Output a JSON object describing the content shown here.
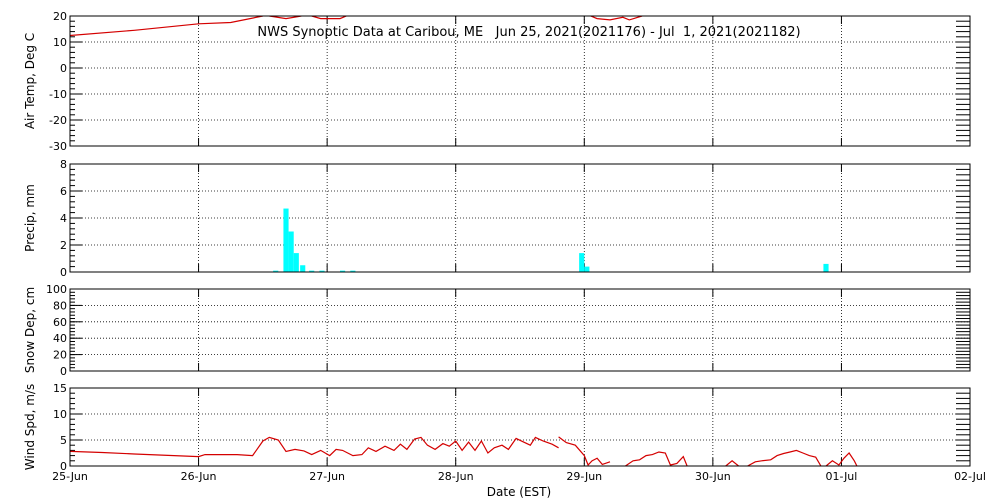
{
  "chart_data": {
    "type": "line",
    "title": "NWS Synoptic Data at Caribou, ME   Jun 25, 2021(2021176) - Jul  1, 2021(2021182)",
    "xlabel": "Date (EST)",
    "x_ticks": [
      "25-Jun",
      "26-Jun",
      "27-Jun",
      "28-Jun",
      "29-Jun",
      "30-Jun",
      "01-Jul",
      "02-Jul"
    ],
    "x_range_days": [
      0,
      7
    ],
    "grid": true,
    "panels": [
      {
        "id": "air-temp",
        "type": "line",
        "ylabel": "Air Temp, Deg C",
        "ylim": [
          -30,
          20
        ],
        "yticks": [
          20,
          10,
          0,
          -10,
          -20,
          -30
        ],
        "color": "#d40000",
        "segments": [
          [
            [
              0.0,
              12.5
            ],
            [
              0.5,
              14.5
            ],
            [
              1.0,
              17.0
            ],
            [
              1.25,
              17.5
            ],
            [
              1.4,
              19.0
            ],
            [
              1.5,
              20.0
            ]
          ],
          [
            [
              1.55,
              20.0
            ],
            [
              1.68,
              19.0
            ],
            [
              1.8,
              20.0
            ]
          ],
          [
            [
              1.88,
              20.0
            ],
            [
              1.95,
              19.0
            ],
            [
              2.1,
              19.0
            ],
            [
              2.15,
              20.0
            ]
          ],
          [
            [
              4.05,
              20.0
            ],
            [
              4.1,
              19.0
            ],
            [
              4.2,
              18.5
            ],
            [
              4.3,
              19.5
            ],
            [
              4.35,
              18.5
            ],
            [
              4.45,
              20.0
            ]
          ]
        ]
      },
      {
        "id": "precip",
        "type": "bar",
        "ylabel": "Precip, mm",
        "ylim": [
          0,
          8
        ],
        "yticks": [
          8,
          6,
          4,
          2,
          0
        ],
        "color": "#00ffff",
        "bar_width_days": 0.04,
        "bars": [
          [
            1.6,
            0.1
          ],
          [
            1.68,
            4.7
          ],
          [
            1.72,
            3.0
          ],
          [
            1.76,
            1.4
          ],
          [
            1.81,
            0.5
          ],
          [
            1.88,
            0.1
          ],
          [
            1.96,
            0.1
          ],
          [
            2.12,
            0.1
          ],
          [
            2.2,
            0.1
          ],
          [
            3.98,
            1.4
          ],
          [
            4.02,
            0.4
          ],
          [
            5.88,
            0.6
          ]
        ]
      },
      {
        "id": "snow-depth",
        "type": "line",
        "ylabel": "Snow Dep, cm",
        "ylim": [
          0,
          100
        ],
        "yticks": [
          100,
          80,
          60,
          40,
          20,
          0
        ],
        "color": "#d40000",
        "segments": []
      },
      {
        "id": "wind-speed",
        "type": "line",
        "ylabel": "Wind Spd, m/s",
        "ylim": [
          0,
          15
        ],
        "yticks": [
          15,
          10,
          5,
          0
        ],
        "color": "#d40000",
        "segments": [
          [
            [
              0.0,
              2.8
            ],
            [
              0.25,
              2.6
            ],
            [
              0.5,
              2.3
            ],
            [
              1.0,
              1.8
            ],
            [
              1.05,
              2.2
            ],
            [
              1.3,
              2.2
            ],
            [
              1.42,
              2.0
            ],
            [
              1.5,
              4.8
            ],
            [
              1.55,
              5.5
            ],
            [
              1.62,
              5.0
            ],
            [
              1.68,
              2.8
            ],
            [
              1.75,
              3.2
            ],
            [
              1.82,
              2.9
            ],
            [
              1.88,
              2.2
            ],
            [
              1.95,
              3.0
            ],
            [
              2.02,
              2.0
            ],
            [
              2.07,
              3.2
            ],
            [
              2.12,
              3.0
            ],
            [
              2.2,
              2.0
            ],
            [
              2.27,
              2.2
            ],
            [
              2.32,
              3.5
            ],
            [
              2.38,
              2.8
            ],
            [
              2.45,
              3.8
            ],
            [
              2.52,
              3.0
            ],
            [
              2.57,
              4.2
            ],
            [
              2.62,
              3.2
            ],
            [
              2.68,
              5.2
            ],
            [
              2.73,
              5.5
            ],
            [
              2.78,
              4.0
            ],
            [
              2.84,
              3.2
            ],
            [
              2.9,
              4.3
            ],
            [
              2.95,
              3.8
            ],
            [
              3.0,
              4.8
            ],
            [
              3.05,
              3.0
            ],
            [
              3.1,
              4.6
            ],
            [
              3.15,
              3.0
            ],
            [
              3.2,
              4.8
            ],
            [
              3.25,
              2.5
            ],
            [
              3.3,
              3.5
            ],
            [
              3.36,
              4.0
            ],
            [
              3.41,
              3.2
            ],
            [
              3.47,
              5.3
            ],
            [
              3.52,
              4.7
            ],
            [
              3.58,
              4.0
            ],
            [
              3.62,
              5.5
            ],
            [
              3.68,
              4.8
            ],
            [
              3.75,
              4.2
            ],
            [
              3.8,
              3.5
            ]
          ],
          [
            [
              3.8,
              5.6
            ],
            [
              3.86,
              4.5
            ],
            [
              3.93,
              4.0
            ],
            [
              4.0,
              2.0
            ],
            [
              4.03,
              0.2
            ],
            [
              4.06,
              1.0
            ],
            [
              4.1,
              1.5
            ],
            [
              4.14,
              0.3
            ],
            [
              4.2,
              0.8
            ]
          ],
          [
            [
              4.32,
              0.0
            ],
            [
              4.38,
              1.0
            ],
            [
              4.43,
              1.2
            ],
            [
              4.48,
              2.0
            ],
            [
              4.53,
              2.2
            ],
            [
              4.58,
              2.7
            ],
            [
              4.63,
              2.5
            ],
            [
              4.67,
              0.2
            ],
            [
              4.72,
              0.5
            ],
            [
              4.77,
              1.8
            ],
            [
              4.8,
              0.0
            ]
          ],
          [
            [
              5.1,
              0.0
            ],
            [
              5.15,
              1.0
            ],
            [
              5.2,
              0.0
            ]
          ],
          [
            [
              5.27,
              0.0
            ],
            [
              5.33,
              0.8
            ],
            [
              5.38,
              1.0
            ],
            [
              5.45,
              1.2
            ],
            [
              5.5,
              2.0
            ],
            [
              5.55,
              2.4
            ],
            [
              5.6,
              2.7
            ],
            [
              5.65,
              3.0
            ],
            [
              5.7,
              2.5
            ],
            [
              5.75,
              2.0
            ],
            [
              5.8,
              1.7
            ],
            [
              5.84,
              0.0
            ]
          ],
          [
            [
              5.88,
              0.0
            ],
            [
              5.93,
              1.0
            ],
            [
              5.98,
              0.2
            ],
            [
              6.02,
              1.5
            ],
            [
              6.06,
              2.5
            ],
            [
              6.1,
              1.0
            ],
            [
              6.12,
              0.0
            ]
          ]
        ]
      }
    ]
  }
}
